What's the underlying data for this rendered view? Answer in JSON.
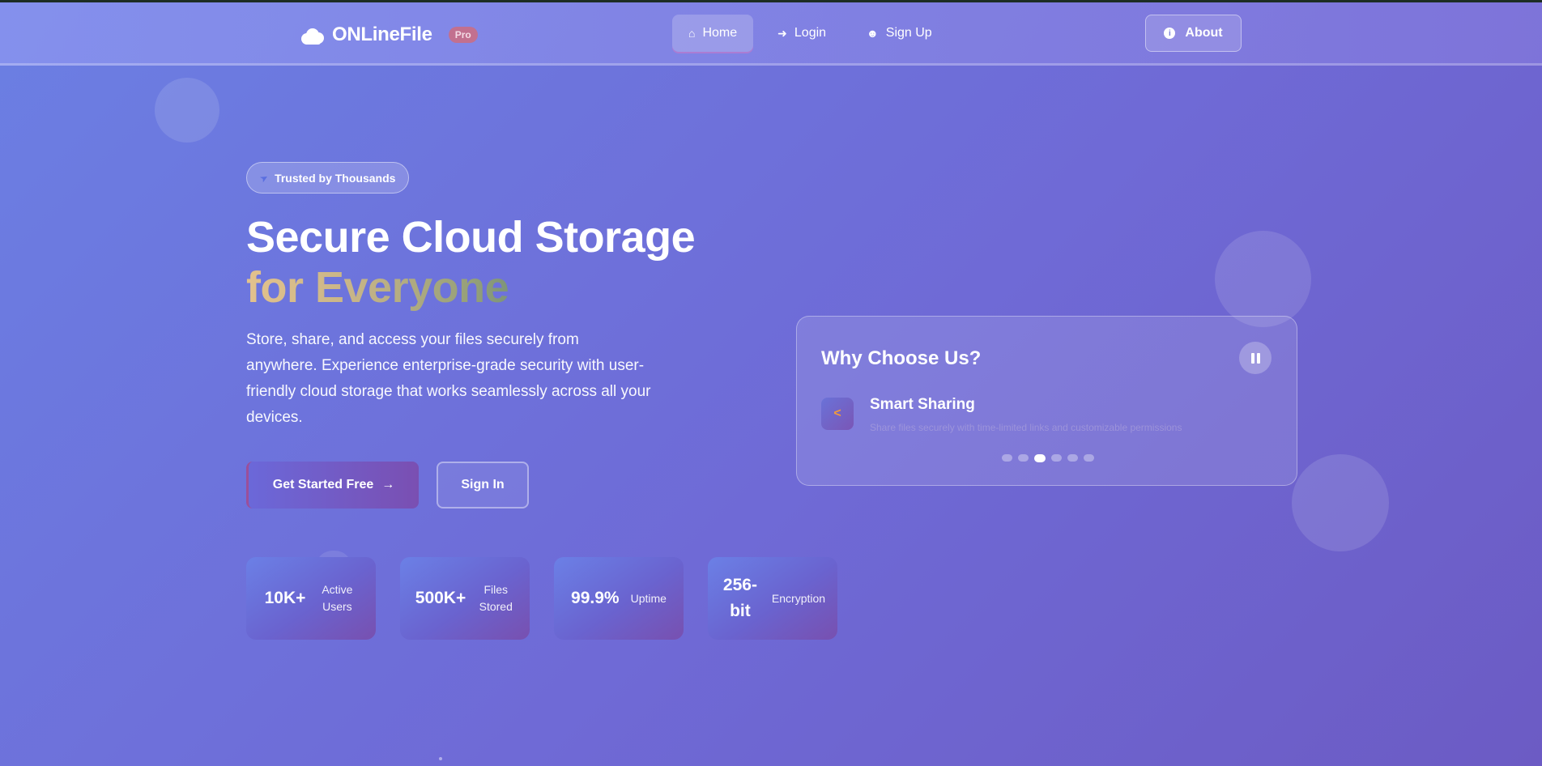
{
  "navbar": {
    "brand": "ONLineFile",
    "badge": "Pro",
    "links": [
      {
        "label": "Home",
        "icon": "home-icon"
      },
      {
        "label": "Login",
        "icon": "login-icon"
      },
      {
        "label": "Sign Up",
        "icon": "user-plus-icon"
      }
    ],
    "about_label": "About"
  },
  "hero": {
    "badge": "Trusted by Thousands",
    "title_line1": "Secure Cloud Storage",
    "title_line2": "for Everyone",
    "description": "Store, share, and access your files securely from anywhere. Experience enterprise-grade security with user-friendly cloud storage that works seamlessly across all your devices.",
    "primary_cta": "Get Started Free",
    "secondary_cta": "Sign In",
    "stats": [
      {
        "value": "10K+",
        "label": "Active Users"
      },
      {
        "value": "500K+",
        "label": "Files Stored"
      },
      {
        "value": "99.9%",
        "label": "Uptime"
      },
      {
        "value": "256-bit",
        "label": "Encryption"
      }
    ]
  },
  "features_card": {
    "title": "Why Choose Us?",
    "current": {
      "name": "Smart Sharing",
      "description": "Share files securely with time-limited links and customizable permissions",
      "icon": "share-icon"
    },
    "slide_count": 6,
    "active_slide": 3
  },
  "colors": {
    "accent": "#6f6ad6",
    "badge": "#c2708f",
    "feature_icon": "#f39a3a"
  }
}
